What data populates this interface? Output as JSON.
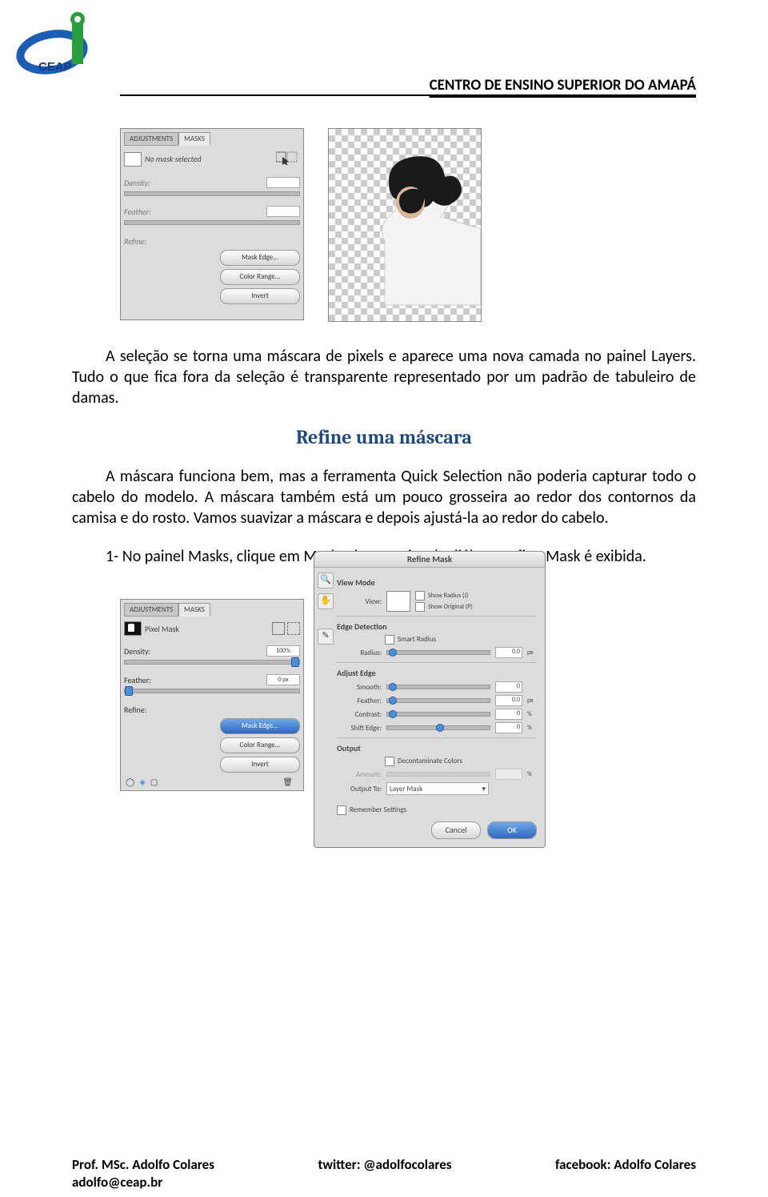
{
  "header": {
    "title": "CENTRO DE ENSINO SUPERIOR DO AMAPÁ"
  },
  "panelA": {
    "tab1": "ADJUSTMENTS",
    "tab2": "MASKS",
    "status": "No mask selected",
    "density": "Density:",
    "feather": "Feather:",
    "refine": "Refine:",
    "btn_mask_edge": "Mask Edge...",
    "btn_color_range": "Color Range...",
    "btn_invert": "Invert"
  },
  "para1": "A seleção se torna uma máscara de pixels e aparece uma nova camada no painel Layers. Tudo o que fica fora da seleção é transparente representado por um padrão de tabuleiro de damas.",
  "h2": "Refine uma máscara",
  "para2": "A máscara funciona bem, mas a ferramenta Quick Selection não poderia capturar todo o cabelo do modelo. A máscara também está um pouco grosseira ao redor dos contornos da camisa e do rosto. Vamos suavizar a máscara e depois ajustá-la ao redor do cabelo.",
  "list1": "1- No painel Masks, clique em Mask Edge. A caixa de diálogo Refine Mask é exibida.",
  "panelB": {
    "tab1": "ADJUSTMENTS",
    "tab2": "MASKS",
    "status": "Pixel Mask",
    "density": "Density:",
    "density_val": "100%",
    "feather": "Feather:",
    "feather_val": "0 px",
    "refine": "Refine:",
    "btn_mask_edge": "Mask Edge...",
    "btn_color_range": "Color Range...",
    "btn_invert": "Invert"
  },
  "dialog": {
    "title": "Refine Mask",
    "view_mode": "View Mode",
    "view": "View:",
    "show_radius": "Show Radius (J)",
    "show_original": "Show Original (P)",
    "edge_detection": "Edge Detection",
    "smart_radius": "Smart Radius",
    "radius": "Radius:",
    "radius_val": "0.0",
    "px": "px",
    "adjust_edge": "Adjust Edge",
    "smooth": "Smooth:",
    "smooth_val": "0",
    "feather": "Feather:",
    "feather_val": "0.0",
    "contrast": "Contrast:",
    "contrast_val": "0",
    "pct": "%",
    "shift_edge": "Shift Edge:",
    "shift_val": "0",
    "output": "Output",
    "decontaminate": "Decontaminate Colors",
    "amount": "Amount:",
    "output_to": "Output To:",
    "output_sel": "Layer Mask",
    "remember": "Remember Settings",
    "cancel": "Cancel",
    "ok": "OK"
  },
  "footer": {
    "left": "Prof. MSc. Adolfo Colares",
    "center": "twitter: @adolfocolares",
    "right": "facebook: Adolfo Colares",
    "email": "adolfo@ceap.br"
  }
}
